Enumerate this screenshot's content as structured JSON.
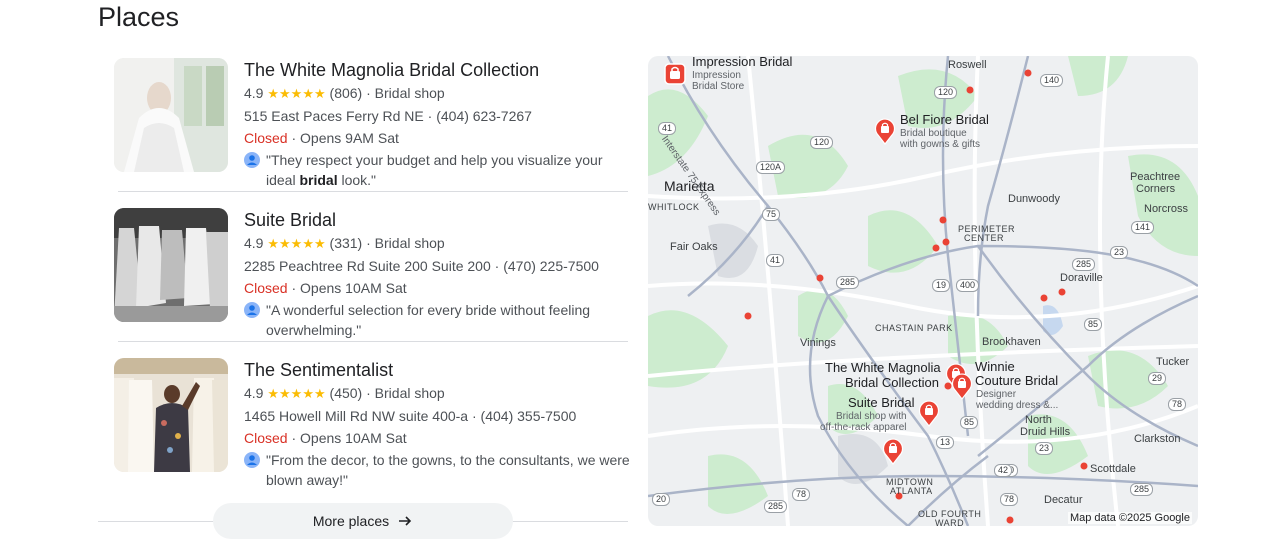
{
  "section_title": "Places",
  "places": [
    {
      "name": "The White Magnolia Bridal Collection",
      "rating": "4.9",
      "stars": "★★★★★",
      "reviews": "(806)",
      "category": "Bridal shop",
      "address": "515 East Paces Ferry Rd NE",
      "phone": "(404) 623-7267",
      "status": "Closed",
      "hours": "Opens 9AM Sat",
      "review_pre": "\"They respect your budget and help you visualize your ideal ",
      "review_bold": "bridal",
      "review_post": " look.\""
    },
    {
      "name": "Suite Bridal",
      "rating": "4.9",
      "stars": "★★★★★",
      "reviews": "(331)",
      "category": "Bridal shop",
      "address": "2285 Peachtree Rd Suite 200 Suite 200",
      "phone": "(470) 225-7500",
      "status": "Closed",
      "hours": "Opens 10AM Sat",
      "review_pre": "\"A wonderful selection for every bride without feeling overwhelming.\"",
      "review_bold": "",
      "review_post": ""
    },
    {
      "name": "The Sentimentalist",
      "rating": "4.9",
      "stars": "★★★★★",
      "reviews": "(450)",
      "category": "Bridal shop",
      "address": "1465 Howell Mill Rd NW suite 400-a",
      "phone": "(404) 355-7500",
      "status": "Closed",
      "hours": "Opens 10AM Sat",
      "review_pre": "\"From the decor, to the gowns, to the consultants, we were blown away!\"",
      "review_bold": "",
      "review_post": ""
    }
  ],
  "separator": "·",
  "more_places_label": "More places",
  "map": {
    "attribution": "Map data ©2025 Google",
    "places": {
      "impression": {
        "name": "Impression Bridal",
        "sub1": "Impression",
        "sub2": "Bridal Store"
      },
      "belfiore": {
        "name": "Bel Fiore Bridal",
        "sub1": "Bridal boutique",
        "sub2": "with gowns & gifts"
      },
      "magnolia": {
        "line1": "The White Magnolia",
        "line2": "Bridal Collection"
      },
      "winnie": {
        "line1": "Winnie",
        "line2": "Couture Bridal",
        "sub1": "Designer",
        "sub2": "wedding dress &..."
      },
      "suite": {
        "name": "Suite Bridal",
        "sub1": "Bridal shop with",
        "sub2": "off-the-rack apparel"
      }
    },
    "labels": {
      "roswell": "Roswell",
      "marietta": "Marietta",
      "whitlock": "WHITLOCK",
      "fair_oaks": "Fair Oaks",
      "dunwoody": "Dunwoody",
      "perimeter1": "PERIMETER",
      "perimeter2": "CENTER",
      "peachtree1": "Peachtree",
      "peachtree2": "Corners",
      "norcross": "Norcross",
      "doraville": "Doraville",
      "chastain": "CHASTAIN PARK",
      "vinings": "Vinings",
      "brookhaven": "Brookhaven",
      "tucker": "Tucker",
      "north1": "North",
      "north2": "Druid Hills",
      "clarkston": "Clarkston",
      "scottdale": "Scottdale",
      "midtown1": "MIDTOWN",
      "midtown2": "ATLANTA",
      "oldfourth1": "OLD FOURTH",
      "oldfourth2": "WARD",
      "decatur": "Decatur",
      "i75exp": "Interstate 75 Express"
    },
    "shields": [
      "140",
      "120",
      "41",
      "120",
      "120A",
      "75",
      "41",
      "285",
      "19",
      "400",
      "141",
      "285",
      "23",
      "85",
      "29",
      "78",
      "85",
      "23",
      "10",
      "285",
      "42",
      "13",
      "78",
      "285",
      "78",
      "20"
    ]
  },
  "colors": {
    "accent_red": "#d93025",
    "star": "#fbbc04",
    "pin": "#ea4335",
    "road": "#aab4c8",
    "park": "#cdeccf"
  }
}
